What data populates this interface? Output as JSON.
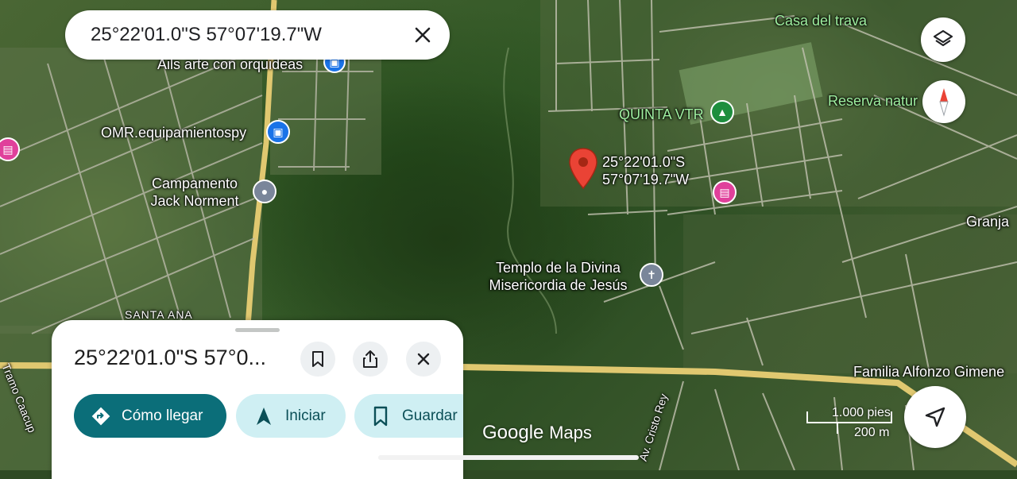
{
  "search": {
    "query": "25°22'01.0\"S 57°07'19.7\"W"
  },
  "pin": {
    "label_line1": "25°22'01.0\"S",
    "label_line2": "57°07'19.7\"W"
  },
  "map_labels": {
    "casa_del_trava": "Casa del trava",
    "ails_arte": "Ails arte con orquideas",
    "omr": "OMR.equipamientospy",
    "campamento_line1": "Campamento",
    "campamento_line2": "Jack Norment",
    "quinta_vtr": "QUINTA VTR",
    "reserva": "Reserva natur",
    "granja": "Granja",
    "templo_line1": "Templo de la Divina",
    "templo_line2": "Misericordia de Jesús",
    "santa_ana": "SANTA ANA",
    "familia": "Familia Alfonzo Gimene",
    "tramo": "Tramo Caacup",
    "av_cristo_rey": "Av. Cristo Rey"
  },
  "sheet": {
    "title": "25°22'01.0\"S 57°0...",
    "directions_label": "Cómo llegar",
    "start_label": "Iniciar",
    "save_label": "Guardar"
  },
  "attribution": {
    "google": "Google",
    "maps": "Maps"
  },
  "scale": {
    "imperial": "1.000 pies",
    "metric": "200 m"
  },
  "colors": {
    "primary_chip": "#0b6e79",
    "secondary_chip": "#cfeff3",
    "pin": "#ea4335",
    "poi_label_green": "#9ff0a0"
  }
}
